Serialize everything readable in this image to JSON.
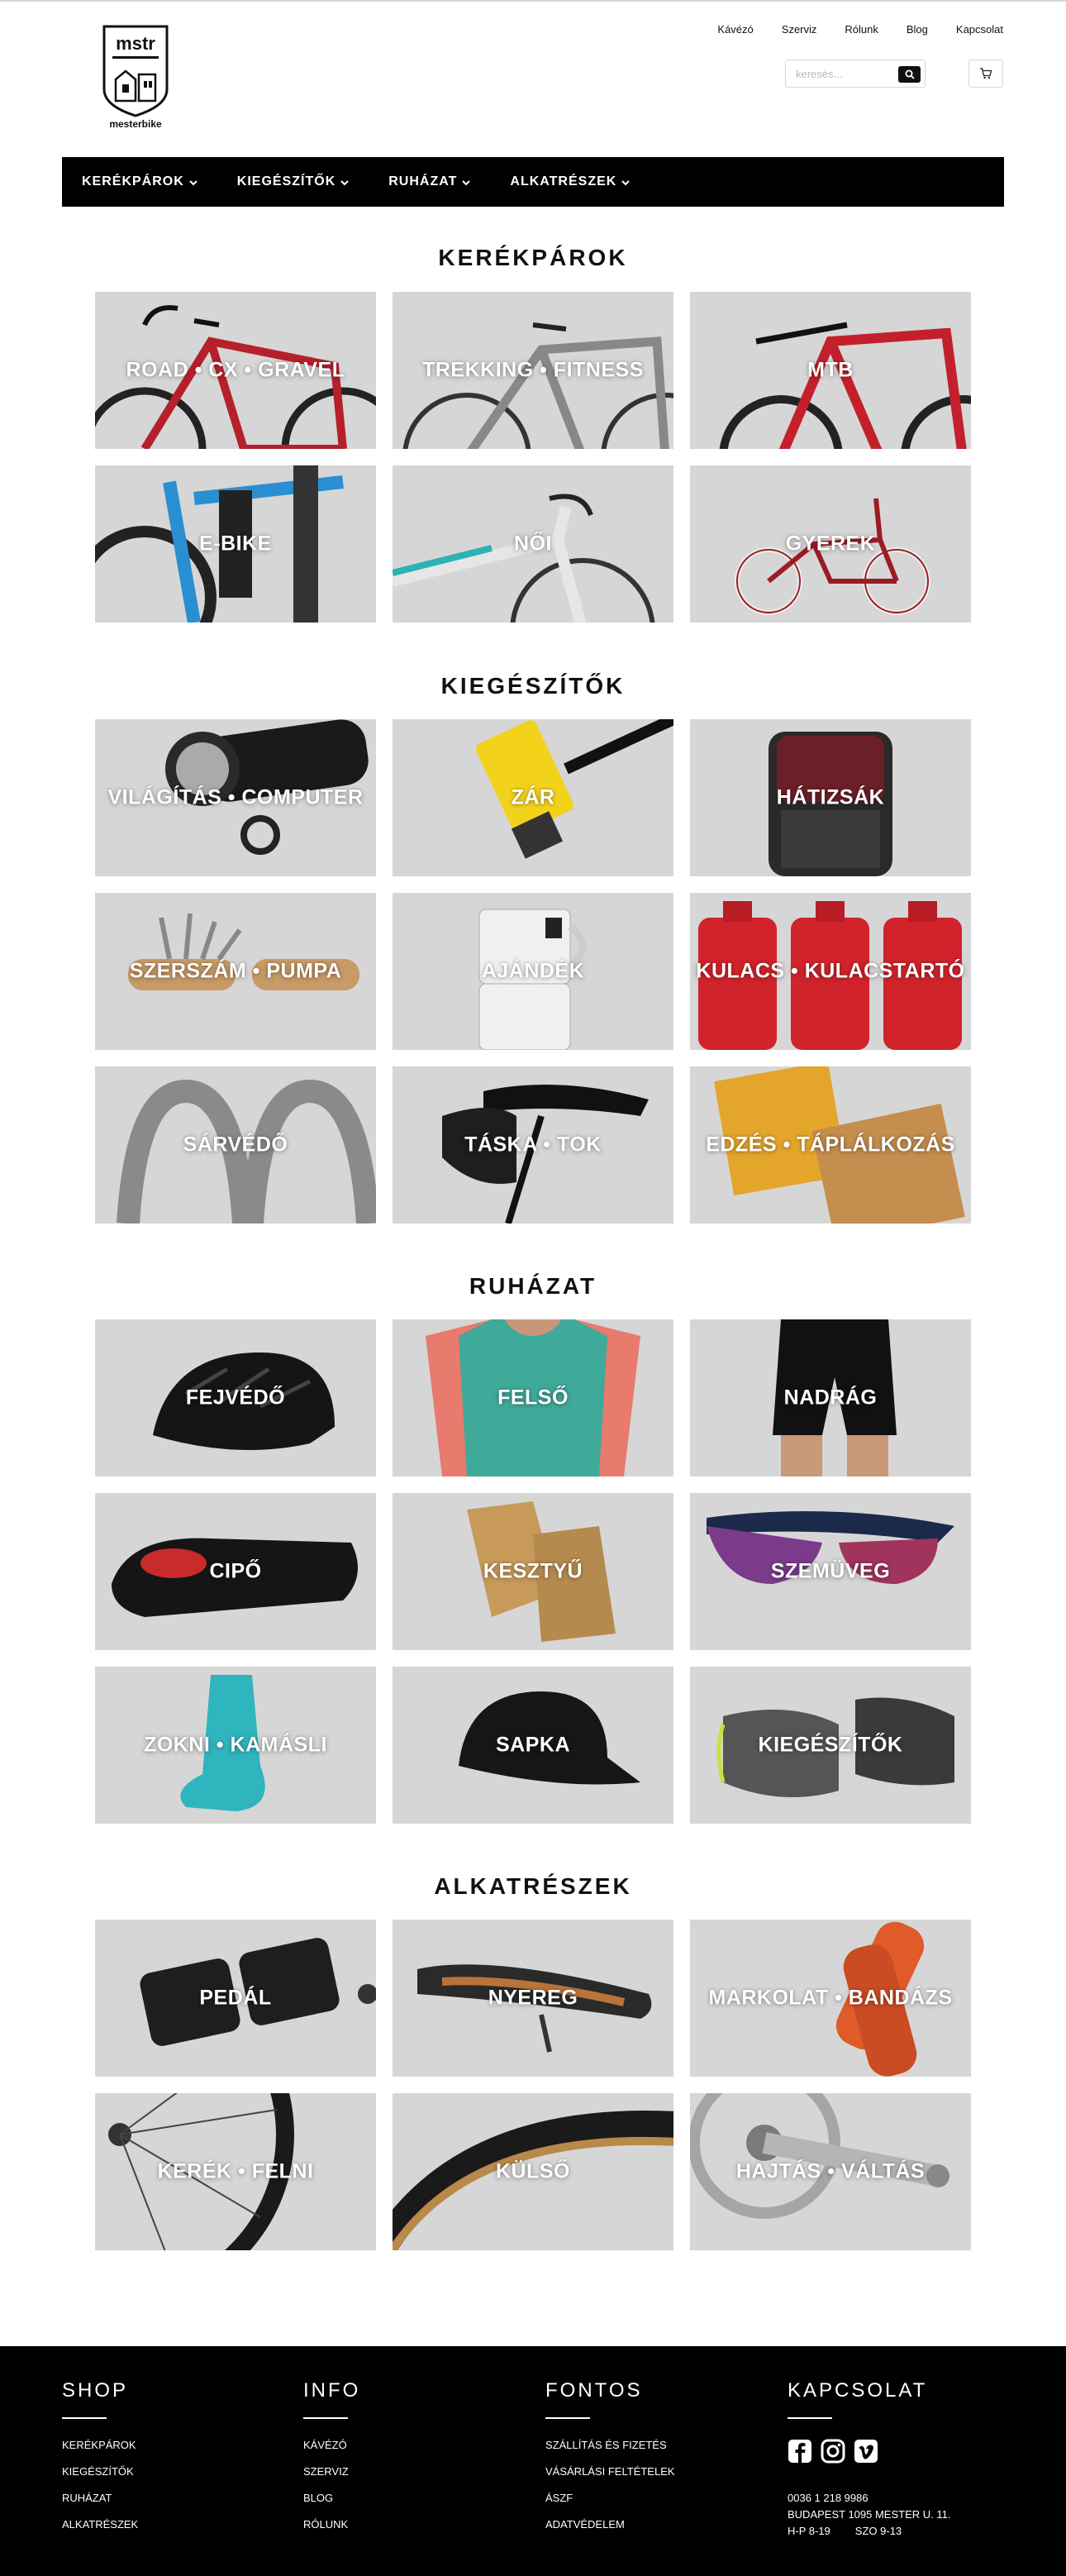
{
  "header": {
    "logo_text": "mstr",
    "logo_subtitle": "mesterbike",
    "top_links": [
      "Kávézó",
      "Szerviz",
      "Rólunk",
      "Blog",
      "Kapcsolat"
    ],
    "search_placeholder": "keresés...",
    "search_icon": "search-icon",
    "cart_icon": "cart-icon"
  },
  "nav": {
    "items": [
      "KERÉKPÁROK",
      "KIEGÉSZÍTŐK",
      "RUHÁZAT",
      "ALKATRÉSZEK"
    ],
    "dropdown_icon": "chevron-down-icon"
  },
  "sections": [
    {
      "title": "KERÉKPÁROK",
      "tiles": [
        "ROAD • CX • GRAVEL",
        "TREKKING • FITNESS",
        "MTB",
        "E-BIKE",
        "NŐI",
        "GYEREK"
      ]
    },
    {
      "title": "KIEGÉSZÍTŐK",
      "tiles": [
        "VILÁGÍTÁS • COMPUTER",
        "ZÁR",
        "HÁTIZSÁK",
        "SZERSZÁM • PUMPA",
        "AJÁNDÉK",
        "KULACS • KULACSTARTÓ",
        "SÁRVÉDŐ",
        "TÁSKA • TOK",
        "EDZÉS • TÁPLÁLKOZÁS"
      ]
    },
    {
      "title": "RUHÁZAT",
      "tiles": [
        "FEJVÉDŐ",
        "FELSŐ",
        "NADRÁG",
        "CIPŐ",
        "KESZTYŰ",
        "SZEMÜVEG",
        "ZOKNI • KAMÁSLI",
        "SAPKA",
        "KIEGÉSZÍTŐK"
      ]
    },
    {
      "title": "ALKATRÉSZEK",
      "tiles": [
        "PEDÁL",
        "NYEREG",
        "MARKOLAT • BANDÁZS",
        "KERÉK • FELNI",
        "KÜLSŐ",
        "HAJTÁS • VÁLTÁS"
      ]
    }
  ],
  "footer": {
    "shop": {
      "title": "SHOP",
      "links": [
        "KERÉKPÁROK",
        "KIEGÉSZÍTŐK",
        "RUHÁZAT",
        "ALKATRÉSZEK"
      ]
    },
    "info": {
      "title": "INFO",
      "links": [
        "KÁVÉZÓ",
        "SZERVIZ",
        "BLOG",
        "RÓLUNK"
      ]
    },
    "fontos": {
      "title": "FONTOS",
      "links": [
        "SZÁLLÍTÁS ÉS FIZETÉS",
        "VÁSÁRLÁSI FELTÉTELEK",
        "ÁSZF",
        "ADATVÉDELEM"
      ]
    },
    "kapcsolat": {
      "title": "KAPCSOLAT",
      "social_icons": [
        "facebook-icon",
        "instagram-icon",
        "vimeo-icon"
      ],
      "phone": "0036 1 218 9986",
      "address": "BUDAPEST 1095 MESTER U. 11.",
      "hours_weekday": "H-P 8-19",
      "hours_saturday": "SZO 9-13"
    }
  }
}
